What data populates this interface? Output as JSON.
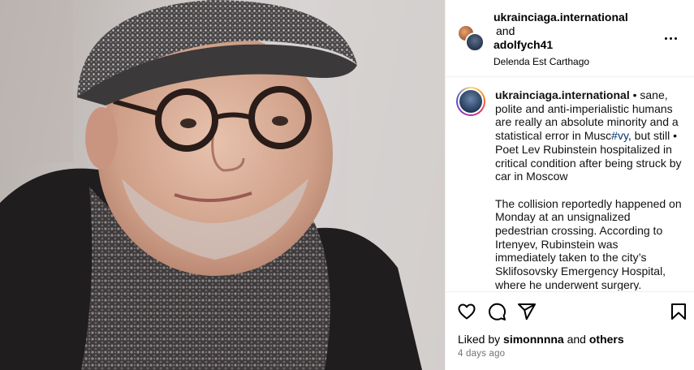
{
  "header": {
    "author": "ukrainciaga.international",
    "and_label": "and",
    "coauthor": "adolfych41",
    "subtitle": "Delenda Est Carthago",
    "more_icon": "more-horizontal-icon"
  },
  "caption": {
    "user": "ukrainciaga.international",
    "text_before_tag": " • sane, polite and anti-imperialistic humans are really an absolute minority and a statistical error in Musc",
    "tag": "#vy",
    "text_after_tag": ", but still • Poet Lev Rubinstein hospitalized in critical condition after being struck by car in Moscow",
    "paragraph2": "The collision reportedly happened on Monday at an unsignalized pedestrian crossing. According to Irtenyev, Rubinstein was immediately taken to the city’s Sklifosovsky Emergency Hospital, where he underwent surgery."
  },
  "actions": {
    "icons": [
      "heart-icon",
      "comment-icon",
      "share-icon",
      "bookmark-icon"
    ]
  },
  "likes": {
    "prefix": "Liked by ",
    "user": "simonnnna",
    "middle": " and ",
    "others": "others"
  },
  "timestamp": "4 days ago",
  "colors": {
    "link": "#00376b",
    "muted": "#737373",
    "divider": "#efefef"
  }
}
